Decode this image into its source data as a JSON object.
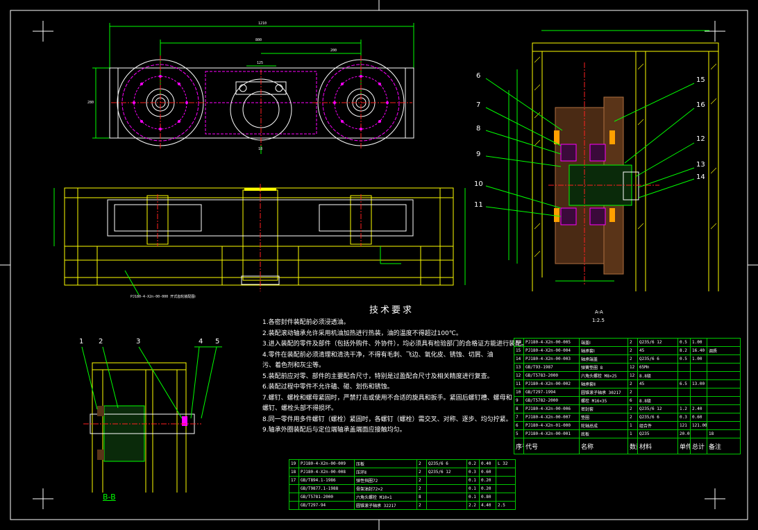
{
  "tech_requirements": {
    "title": "技术要求",
    "items": [
      "1.各密封件装配前必须浸透油。",
      "2.装配滚动轴承允许采用机油加热进行热装，油的温度不得超过100℃。",
      "3.进入装配的零件及部件（包括外购件、外协件），均必须具有检验部门的合格证方能进行装配。",
      "4.零件在装配前必须清理和清洗干净，不得有毛刺、飞边、氧化皮、锈蚀、切屑、油污、着色剂和灰尘等。",
      "5.装配前应对零、部件的主要配合尺寸，特别是过盈配合尺寸及相关精度进行复查。",
      "6.装配过程中零件不允许磕、碰、划伤和锈蚀。",
      "7.螺钉、螺栓和螺母紧固时，严禁打击或使用不合适的旋具和扳手。紧固后螺钉槽、螺母和螺钉、螺栓头部不得损坏。",
      "8.同一零件用多件螺钉（螺栓）紧固时，各螺钉（螺栓）需交叉、对称、逐步、均匀拧紧。",
      "9.轴承外圈装配后与定位端轴承盖端面应接触均匀。"
    ]
  },
  "section_labels": {
    "bb": "B-B",
    "aa": "A-A",
    "aa_scale": "1:2.5"
  },
  "view_numbers": {
    "bb_parts": [
      "1",
      "2",
      "3",
      "4",
      "5"
    ],
    "aa_parts": [
      "6",
      "7",
      "8",
      "9",
      "10",
      "11",
      "12",
      "13",
      "14",
      "15",
      "16"
    ]
  },
  "top_dims": {
    "d1": "1210",
    "d2": "800",
    "d3": "200",
    "d4": "125",
    "d5": "280",
    "d6": "18"
  },
  "parts_list_right": {
    "rows": [
      [
        "16",
        "PJ180-4-X2n-00-005",
        "端盖Ⅰ",
        "2",
        "Q235/6 12",
        "0.5",
        "1.00",
        ""
      ],
      [
        "15",
        "PJ180-4-X2n-00-004",
        "轴承套Ⅰ",
        "2",
        "45",
        "8.2",
        "16.40",
        "调质"
      ],
      [
        "14",
        "PJ180-4-X2n-00-003",
        "轴承端盖",
        "2",
        "Q235/6 6",
        "0.5",
        "1.00",
        ""
      ],
      [
        "13",
        "GB/T93-1987",
        "弹簧垫圈 8",
        "12",
        "65Mn",
        "",
        "",
        ""
      ],
      [
        "12",
        "GB/T5783-2000",
        "六角头螺栓 M8×25",
        "12",
        "8.8级",
        "",
        "",
        ""
      ],
      [
        "11",
        "PJ180-4-X2n-00-002",
        "轴承套Ⅱ",
        "2",
        "45",
        "6.5",
        "13.00",
        ""
      ],
      [
        "10",
        "GB/T297-1994",
        "圆锥滚子轴承 30217",
        "2",
        "",
        "",
        "",
        ""
      ],
      [
        "9",
        "GB/T5782-2000",
        "螺栓 M16×35",
        "6",
        "8.8级",
        "",
        "",
        ""
      ],
      [
        "8",
        "PJ180-4-X2n-00-006",
        "密封套",
        "2",
        "Q235/6 12",
        "1.2",
        "2.40",
        ""
      ],
      [
        "7",
        "PJ180-4-X2n-00-007",
        "垫圈",
        "2",
        "Q235/6 6",
        "0.3",
        "0.60",
        ""
      ],
      [
        "6",
        "PJ180-4-X2n-01-000",
        "轮轴总成",
        "1",
        "组合件",
        "121",
        "121.00",
        ""
      ],
      [
        "5",
        "PJ180-4-X2n-00-001",
        "底板",
        "1",
        "Q235",
        "20.00",
        "",
        "18"
      ]
    ],
    "header": [
      "序号",
      "代号",
      "名称",
      "数量",
      "材料",
      "单件",
      "总计",
      "备注"
    ],
    "header_sub": "重量"
  },
  "parts_list_bottom": {
    "rows": [
      [
        "19",
        "PJ180-4-X2n-00-009",
        "压板",
        "2",
        "Q235/6 6",
        "0.2",
        "0.40",
        "L 32"
      ],
      [
        "18",
        "PJ180-4-X2n-00-008",
        "压环Ⅱ",
        "2",
        "Q235/6 12",
        "0.3",
        "0.60",
        ""
      ],
      [
        "17",
        "GB/T894.1-1986",
        "弹性挡圈72",
        "2",
        "",
        "0.1",
        "0.20",
        ""
      ],
      [
        "",
        "GB/T9877.1-1988",
        "骨架油封72×2",
        "2",
        "",
        "0.1",
        "0.20",
        ""
      ],
      [
        "",
        "GB/T5781-2000",
        "六角头螺栓 M10×1",
        "8",
        "",
        "0.1",
        "0.80",
        ""
      ],
      [
        "",
        "GB/T297-94",
        "圆锥滚子轴承 32217",
        "2",
        "",
        "2.2",
        "4.40",
        "2.5"
      ]
    ]
  },
  "leader_note": "PJ180-4-X2n-00-000 开式齿轮装配图Ⅰ"
}
